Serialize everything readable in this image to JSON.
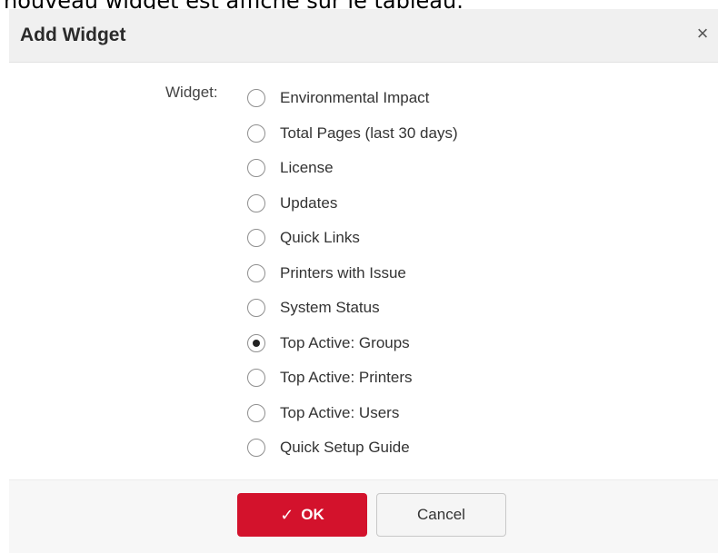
{
  "background_text": "nouveau widget est affiché sur le tableau.",
  "dialog": {
    "title": "Add Widget",
    "close_icon": "close-icon"
  },
  "form": {
    "label": "Widget:",
    "options": [
      {
        "label": "Environmental Impact",
        "checked": false
      },
      {
        "label": "Total Pages (last 30 days)",
        "checked": false
      },
      {
        "label": "License",
        "checked": false
      },
      {
        "label": "Updates",
        "checked": false
      },
      {
        "label": "Quick Links",
        "checked": false
      },
      {
        "label": "Printers with Issue",
        "checked": false
      },
      {
        "label": "System Status",
        "checked": false
      },
      {
        "label": "Top Active: Groups",
        "checked": true
      },
      {
        "label": "Top Active: Printers",
        "checked": false
      },
      {
        "label": "Top Active: Users",
        "checked": false
      },
      {
        "label": "Quick Setup Guide",
        "checked": false
      }
    ],
    "selected": "Top Active: Groups"
  },
  "footer": {
    "ok_label": "OK",
    "ok_icon": "check-icon",
    "cancel_label": "Cancel"
  },
  "colors": {
    "accent": "#d3122c",
    "header_bg": "#f0f0f0"
  }
}
